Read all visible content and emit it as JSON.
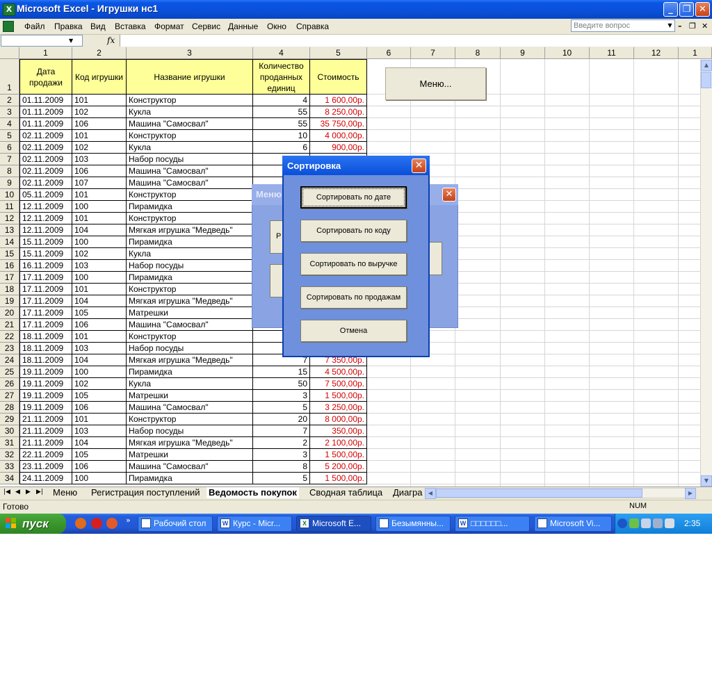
{
  "window": {
    "title": "Microsoft Excel - Игрушки нс1",
    "app_icon": "excel-icon"
  },
  "menu": [
    "Файл",
    "Правка",
    "Вид",
    "Вставка",
    "Формат",
    "Сервис",
    "Данные",
    "Окно",
    "Справка"
  ],
  "help_search": {
    "placeholder": "Введите вопрос"
  },
  "formula_bar": {
    "fx_label": "fx",
    "value": ""
  },
  "columns": [
    "1",
    "2",
    "3",
    "4",
    "5",
    "6",
    "7",
    "8",
    "9",
    "10",
    "11",
    "12",
    "1"
  ],
  "table_header": {
    "row": "1",
    "date": "Дата продажи",
    "code": "Код игрушки",
    "name": "Название игрушки",
    "qty": "Количество проданных единиц",
    "cost": "Стоимость"
  },
  "rows": [
    {
      "row": "2",
      "date": "01.11.2009",
      "code": "101",
      "name": "Конструктор",
      "qty": "4",
      "cost": "1 600,00р."
    },
    {
      "row": "3",
      "date": "01.11.2009",
      "code": "102",
      "name": "Кукла",
      "qty": "55",
      "cost": "8 250,00р."
    },
    {
      "row": "4",
      "date": "01.11.2009",
      "code": "106",
      "name": "Машина \"Самосвал\"",
      "qty": "55",
      "cost": "35 750,00р."
    },
    {
      "row": "5",
      "date": "02.11.2009",
      "code": "101",
      "name": "Конструктор",
      "qty": "10",
      "cost": "4 000,00р."
    },
    {
      "row": "6",
      "date": "02.11.2009",
      "code": "102",
      "name": "Кукла",
      "qty": "6",
      "cost": "900,00р."
    },
    {
      "row": "7",
      "date": "02.11.2009",
      "code": "103",
      "name": "Набор посуды",
      "qty": "",
      "cost": ""
    },
    {
      "row": "8",
      "date": "02.11.2009",
      "code": "106",
      "name": "Машина \"Самосвал\"",
      "qty": "",
      "cost": ""
    },
    {
      "row": "9",
      "date": "02.11.2009",
      "code": "107",
      "name": "Машина \"Самосвал\"",
      "qty": "",
      "cost": ""
    },
    {
      "row": "10",
      "date": "05.11.2009",
      "code": "101",
      "name": "Конструктор",
      "qty": "",
      "cost": ""
    },
    {
      "row": "11",
      "date": "12.11.2009",
      "code": "100",
      "name": "Пирамидка",
      "qty": "",
      "cost": ""
    },
    {
      "row": "12",
      "date": "12.11.2009",
      "code": "101",
      "name": "Конструктор",
      "qty": "",
      "cost": ""
    },
    {
      "row": "13",
      "date": "12.11.2009",
      "code": "104",
      "name": "Мягкая игрушка \"Медведь\"",
      "qty": "",
      "cost": ""
    },
    {
      "row": "14",
      "date": "15.11.2009",
      "code": "100",
      "name": "Пирамидка",
      "qty": "",
      "cost": ""
    },
    {
      "row": "15",
      "date": "15.11.2009",
      "code": "102",
      "name": "Кукла",
      "qty": "",
      "cost": ""
    },
    {
      "row": "16",
      "date": "16.11.2009",
      "code": "103",
      "name": "Набор посуды",
      "qty": "",
      "cost": ""
    },
    {
      "row": "17",
      "date": "17.11.2009",
      "code": "100",
      "name": "Пирамидка",
      "qty": "",
      "cost": ""
    },
    {
      "row": "18",
      "date": "17.11.2009",
      "code": "101",
      "name": "Конструктор",
      "qty": "",
      "cost": ""
    },
    {
      "row": "19",
      "date": "17.11.2009",
      "code": "104",
      "name": "Мягкая игрушка \"Медведь\"",
      "qty": "",
      "cost": ""
    },
    {
      "row": "20",
      "date": "17.11.2009",
      "code": "105",
      "name": "Матрешки",
      "qty": "",
      "cost": ""
    },
    {
      "row": "21",
      "date": "17.11.2009",
      "code": "106",
      "name": "Машина \"Самосвал\"",
      "qty": "",
      "cost": ""
    },
    {
      "row": "22",
      "date": "18.11.2009",
      "code": "101",
      "name": "Конструктор",
      "qty": "",
      "cost": ""
    },
    {
      "row": "23",
      "date": "18.11.2009",
      "code": "103",
      "name": "Набор посуды",
      "qty": "",
      "cost": ""
    },
    {
      "row": "24",
      "date": "18.11.2009",
      "code": "104",
      "name": "Мягкая игрушка \"Медведь\"",
      "qty": "7",
      "cost": "7 350,00р."
    },
    {
      "row": "25",
      "date": "19.11.2009",
      "code": "100",
      "name": "Пирамидка",
      "qty": "15",
      "cost": "4 500,00р."
    },
    {
      "row": "26",
      "date": "19.11.2009",
      "code": "102",
      "name": "Кукла",
      "qty": "50",
      "cost": "7 500,00р."
    },
    {
      "row": "27",
      "date": "19.11.2009",
      "code": "105",
      "name": "Матрешки",
      "qty": "3",
      "cost": "1 500,00р."
    },
    {
      "row": "28",
      "date": "19.11.2009",
      "code": "106",
      "name": "Машина \"Самосвал\"",
      "qty": "5",
      "cost": "3 250,00р."
    },
    {
      "row": "29",
      "date": "21.11.2009",
      "code": "101",
      "name": "Конструктор",
      "qty": "20",
      "cost": "8 000,00р."
    },
    {
      "row": "30",
      "date": "21.11.2009",
      "code": "103",
      "name": "Набор посуды",
      "qty": "7",
      "cost": "350,00р."
    },
    {
      "row": "31",
      "date": "21.11.2009",
      "code": "104",
      "name": "Мягкая игрушка \"Медведь\"",
      "qty": "2",
      "cost": "2 100,00р."
    },
    {
      "row": "32",
      "date": "22.11.2009",
      "code": "105",
      "name": "Матрешки",
      "qty": "3",
      "cost": "1 500,00р."
    },
    {
      "row": "33",
      "date": "23.11.2009",
      "code": "106",
      "name": "Машина \"Самосвал\"",
      "qty": "8",
      "cost": "5 200,00р."
    },
    {
      "row": "34",
      "date": "24.11.2009",
      "code": "100",
      "name": "Пирамидка",
      "qty": "5",
      "cost": "1 500,00р."
    }
  ],
  "sheet_button": {
    "label": "Меню..."
  },
  "bg_dialog": {
    "title": "Меню",
    "partial_label": "Р"
  },
  "sort_dialog": {
    "title": "Сортировка",
    "buttons": [
      "Сортировать по дате",
      "Сортировать по коду",
      "Сортировать по выручке",
      "Сортировать по продажам",
      "Отмена"
    ]
  },
  "sheet_tabs": [
    "Меню",
    "Регистрация поступлений",
    "Ведомость покупок",
    "Сводная таблица",
    "Диагра"
  ],
  "active_tab": "Ведомость покупок",
  "status": {
    "text": "Готово",
    "num": "NUM"
  },
  "taskbar": {
    "start": "пуск",
    "tasks": [
      "Рабочий стол",
      "Курс - Micr...",
      "Microsoft E...",
      "Безымянны...",
      "□□□□□□...",
      "Microsoft Vi..."
    ],
    "active_task": "Microsoft E...",
    "clock": "2:35"
  },
  "colors": {
    "title_blue": "#0a4fd9",
    "header_fill": "#ffff99",
    "money_red": "#d40000",
    "chrome": "#ece9d8",
    "dialog_blue": "#6f90dd",
    "start_green": "#3c9a2f"
  }
}
